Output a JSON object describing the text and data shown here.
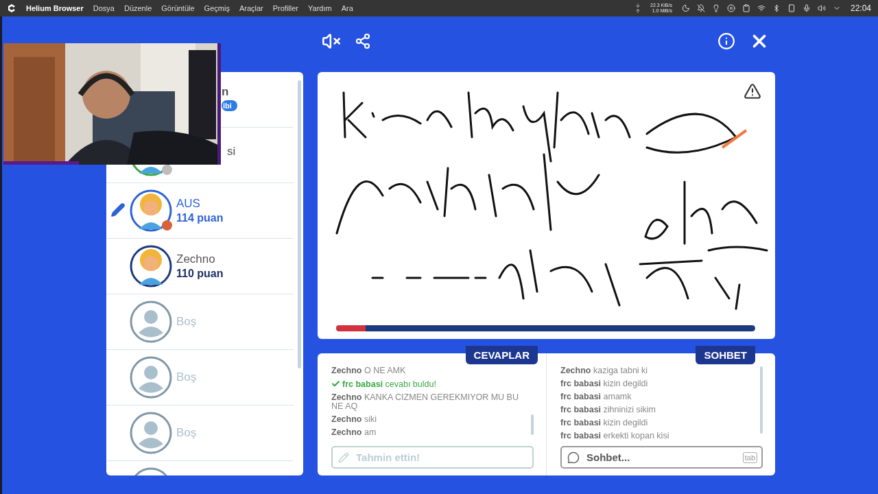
{
  "menu_bar": {
    "app_name": "Helium Browser",
    "menus": [
      "Dosya",
      "Düzenle",
      "Görüntüle",
      "Geçmiş",
      "Araçlar",
      "Profiller",
      "Yardım",
      "Ara"
    ],
    "net_down": "22.3 KiB/s",
    "net_up": "1.0 MiB/s",
    "clock": "22:04"
  },
  "players": [
    {
      "kind": "covered",
      "name": "n",
      "badge": "ibi",
      "drawing": false
    },
    {
      "kind": "covered",
      "name": "si",
      "color": "#bdbdbd",
      "drawing": false
    },
    {
      "kind": "player",
      "name": "AUS",
      "points": "114 puan",
      "color": "#d9623b",
      "drawing": true,
      "selected": true
    },
    {
      "kind": "player",
      "name": "Zechno",
      "points": "110 puan",
      "drawing": false,
      "selected": false
    },
    {
      "kind": "empty",
      "name": "Boş",
      "drawing": false
    },
    {
      "kind": "empty",
      "name": "Boş",
      "drawing": false
    },
    {
      "kind": "empty",
      "name": "Boş",
      "drawing": false
    },
    {
      "kind": "empty",
      "drawing": false
    }
  ],
  "canvas": {
    "round_progress": {
      "level": 0.07
    }
  },
  "answers": {
    "title": "CEVAPLAR",
    "messages": [
      {
        "kind": "message",
        "user": "Zechno",
        "text": "O NE AMK"
      },
      {
        "kind": "correct",
        "user": "frc babasi",
        "text": "cevabı buldu!"
      },
      {
        "kind": "message",
        "user": "Zechno",
        "text": "KANKA CIZMEN GEREKMIYOR MU BU NE AQ"
      },
      {
        "kind": "message",
        "user": "Zechno",
        "text": "siki"
      },
      {
        "kind": "message",
        "user": "Zechno",
        "text": "am"
      }
    ],
    "input": {
      "placeholder": "Tahmin ettin!",
      "disabled": true
    }
  },
  "chat": {
    "title": "SOHBET",
    "messages": [
      {
        "user": "Zechno",
        "text": "kaziga tabni ki"
      },
      {
        "user": "frc babasi",
        "text": "kizin degildi"
      },
      {
        "user": "frc babasi",
        "text": "amamk"
      },
      {
        "user": "frc babasi",
        "text": "zihninizi sikim"
      },
      {
        "user": "frc babasi",
        "text": "kizin degildi"
      },
      {
        "user": "frc babasi",
        "text": "erkekti kopan kisi"
      }
    ],
    "input": {
      "placeholder": "Sohbet...",
      "key_hint": "tab",
      "disabled": false
    }
  }
}
